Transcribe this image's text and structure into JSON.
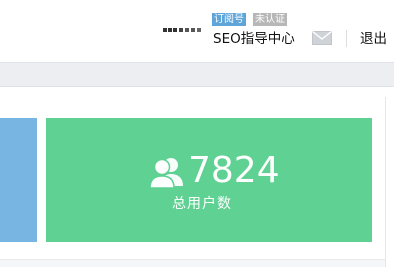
{
  "header": {
    "badges": {
      "subscription": "订阅号",
      "unverified": "未认证"
    },
    "account_name": "SEO指导中心",
    "logout_label": "退出",
    "icons": {
      "account_logo": "account-logo",
      "mail": "mail-icon"
    }
  },
  "dashboard": {
    "users_card": {
      "value": "7824",
      "label": "总用户数",
      "icon": "users-icon"
    }
  },
  "colors": {
    "subscription_badge": "#5fa5d9",
    "unverified_badge": "#b7b7b7",
    "blue_card": "#79b5e2",
    "green_card": "#5fd193",
    "sub_bar": "#eceef2"
  }
}
